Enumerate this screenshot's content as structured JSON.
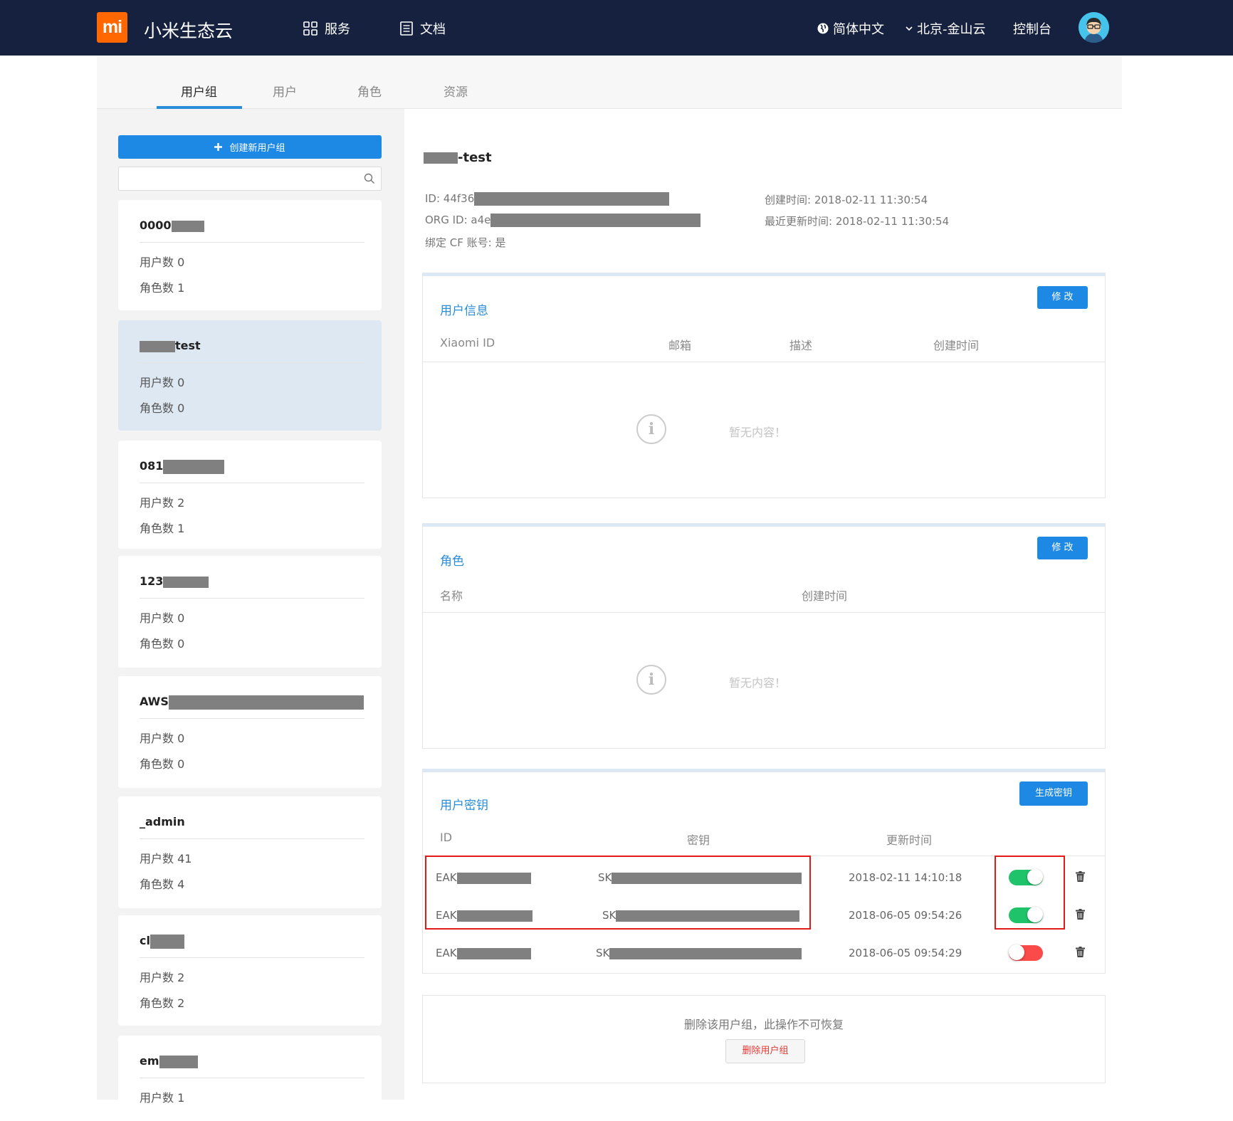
{
  "header": {
    "logo_text": "mi",
    "brand": "小米生态云",
    "nav_services": "服务",
    "nav_docs": "文档",
    "language": "简体中文",
    "region": "北京-金山云",
    "console": "控制台"
  },
  "tabs": [
    "用户组",
    "用户",
    "角色",
    "资源"
  ],
  "sidebar": {
    "create_button": "创建新用户组",
    "search_placeholder": "",
    "groups": [
      {
        "name": "0000",
        "users": "用户数 0",
        "roles": "角色数 1"
      },
      {
        "name": "test",
        "users": "用户数 0",
        "roles": "角色数 0"
      },
      {
        "name": "081",
        "users": "用户数 2",
        "roles": "角色数 1"
      },
      {
        "name": "123",
        "users": "用户数 0",
        "roles": "角色数 0"
      },
      {
        "name": "AWS",
        "users": "用户数 0",
        "roles": "角色数 0"
      },
      {
        "name": "_admin",
        "users": "用户数 41",
        "roles": "角色数 4"
      },
      {
        "name": "cl",
        "users": "用户数 2",
        "roles": "角色数 2"
      },
      {
        "name": "em",
        "users": "用户数 1",
        "roles": ""
      }
    ]
  },
  "detail": {
    "title_suffix": "-test",
    "id_label": "ID: 44f36",
    "org_id_label": "ORG ID: a4e",
    "cf_bound": "绑定 CF 账号: 是",
    "created": "创建时间: 2018-02-11 11:30:54",
    "updated": "最近更新时间: 2018-02-11 11:30:54"
  },
  "user_info": {
    "title": "用户信息",
    "edit": "修 改",
    "columns": [
      "Xiaomi ID",
      "邮箱",
      "描述",
      "创建时间"
    ],
    "empty": "暂无内容！"
  },
  "roles_panel": {
    "title": "角色",
    "edit": "修 改",
    "columns": [
      "名称",
      "创建时间"
    ],
    "empty": "暂无内容！"
  },
  "keys_panel": {
    "title": "用户密钥",
    "generate": "生成密钥",
    "columns": [
      "ID",
      "密钥",
      "更新时间"
    ],
    "rows": [
      {
        "id": "EAK",
        "secret": "SK",
        "time": "2018-02-11 14:10:18",
        "enabled": true
      },
      {
        "id": "EAK",
        "secret": "SK",
        "time": "2018-06-05 09:54:26",
        "enabled": true
      },
      {
        "id": "EAK",
        "secret": "SK",
        "time": "2018-06-05 09:54:29",
        "enabled": false
      }
    ]
  },
  "danger": {
    "text": "删除该用户组，此操作不可恢复",
    "button": "删除用户组"
  },
  "colors": {
    "navbar": "#15213e",
    "brand_orange": "#ff6700",
    "accent_blue": "#1e88e5",
    "toggle_on": "#1fc369",
    "toggle_off": "#fb4a4a",
    "highlight_red": "#e31a1a"
  }
}
